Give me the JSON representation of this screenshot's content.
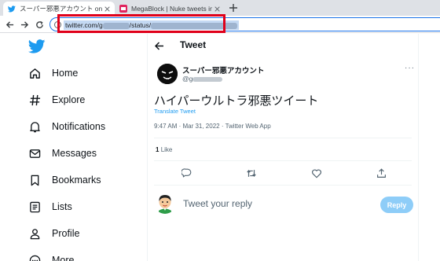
{
  "browser": {
    "tabs": [
      {
        "title": "スーパー邪悪アカウント on Twitter: \"ハ",
        "active": true,
        "favicon": "twitter-bird-icon"
      },
      {
        "title": "MegaBlock | Nuke tweets in one",
        "active": false,
        "favicon": "megablock-icon"
      }
    ],
    "url": {
      "prefix": "twitter.com/g",
      "middle": "/status/"
    },
    "highlight_color": "#e0001a"
  },
  "sidebar": {
    "items": [
      {
        "label": "Home",
        "icon": "home-icon"
      },
      {
        "label": "Explore",
        "icon": "hashtag-icon"
      },
      {
        "label": "Notifications",
        "icon": "bell-icon"
      },
      {
        "label": "Messages",
        "icon": "envelope-icon"
      },
      {
        "label": "Bookmarks",
        "icon": "bookmark-icon"
      },
      {
        "label": "Lists",
        "icon": "list-icon"
      },
      {
        "label": "Profile",
        "icon": "person-icon"
      },
      {
        "label": "More",
        "icon": "more-circle-icon"
      }
    ]
  },
  "tweet": {
    "header": "Tweet",
    "display_name": "スーパー邪悪アカウント",
    "handle_prefix": "@g",
    "text": "ハイパーウルトラ邪悪ツイート",
    "translate": "Translate Tweet",
    "meta": "9:47 AM · Mar 31, 2022 · Twitter Web App",
    "likes_count": "1",
    "likes_label": "Like"
  },
  "reply": {
    "placeholder": "Tweet your reply",
    "button": "Reply"
  },
  "colors": {
    "twitter_blue": "#1d9bf0",
    "reply_button_disabled": "#8ecdf8"
  }
}
